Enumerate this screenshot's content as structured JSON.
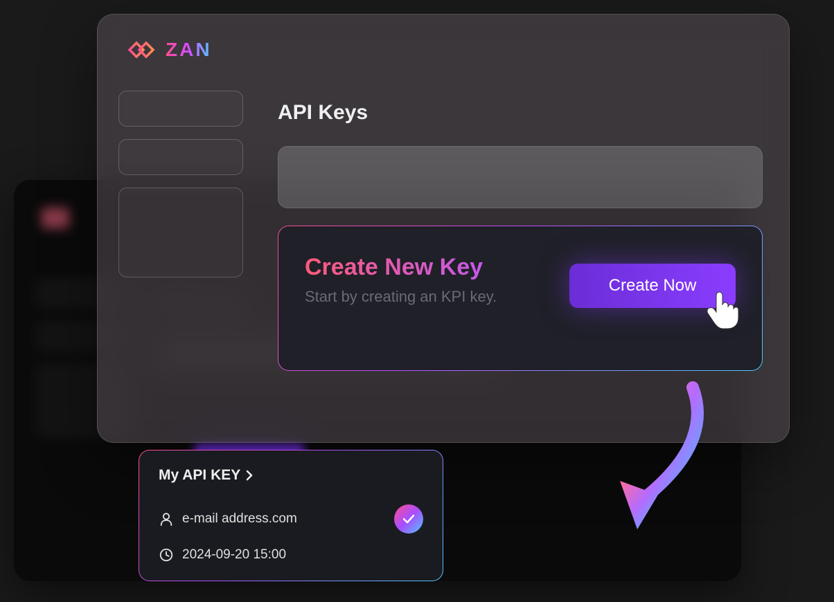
{
  "brand": {
    "name": "ZAN"
  },
  "page": {
    "title": "API Keys"
  },
  "create_card": {
    "title": "Create New Key",
    "subtitle": "Start by creating an KPI key.",
    "button_label": "Create Now"
  },
  "result_card": {
    "title": "My API KEY",
    "email": "e-mail address.com",
    "timestamp": "2024-09-20 15:00"
  },
  "colors": {
    "gradient_start": "#ff4d8f",
    "gradient_mid": "#a84dff",
    "gradient_end": "#4dc9ff",
    "button_primary": "#6b2dd6"
  }
}
